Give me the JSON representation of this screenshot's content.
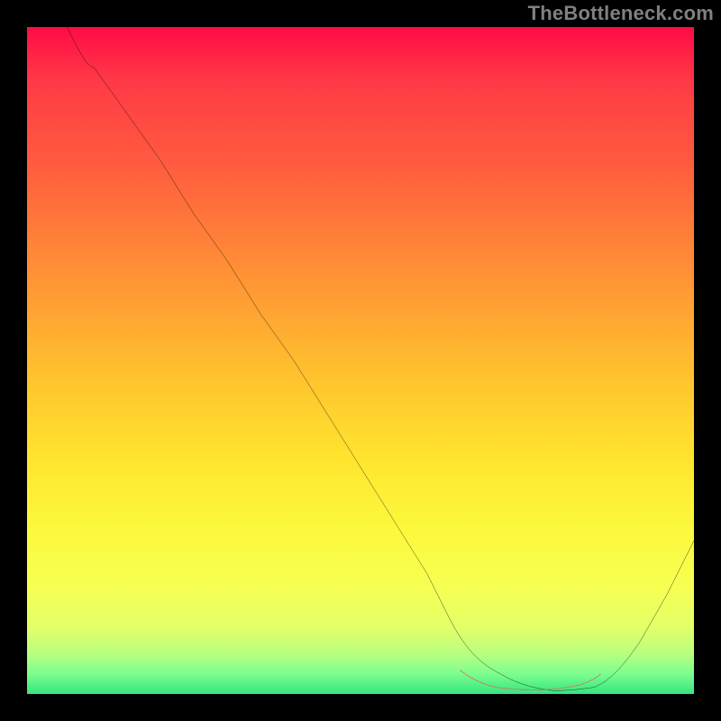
{
  "watermark": "TheBottleneck.com",
  "chart_data": {
    "type": "line",
    "title": "",
    "xlabel": "",
    "ylabel": "",
    "xlim": [
      0,
      100
    ],
    "ylim": [
      0,
      100
    ],
    "grid": false,
    "legend": false,
    "gradient_bands": [
      {
        "y_pct": 0,
        "color": "#34e57f"
      },
      {
        "y_pct": 3,
        "color": "#7cfd8e"
      },
      {
        "y_pct": 6,
        "color": "#b7ff80"
      },
      {
        "y_pct": 10,
        "color": "#e3ff69"
      },
      {
        "y_pct": 16,
        "color": "#f6ff52"
      },
      {
        "y_pct": 25,
        "color": "#fcf83c"
      },
      {
        "y_pct": 35,
        "color": "#ffe52e"
      },
      {
        "y_pct": 48,
        "color": "#ffc12e"
      },
      {
        "y_pct": 65,
        "color": "#ff8b36"
      },
      {
        "y_pct": 80,
        "color": "#ff5a3f"
      },
      {
        "y_pct": 92,
        "color": "#ff3946"
      },
      {
        "y_pct": 100,
        "color": "#ff0b46"
      }
    ],
    "series": [
      {
        "name": "bottleneck-curve",
        "color": "#000000",
        "width": 2,
        "x": [
          6,
          10,
          15,
          20,
          25,
          30,
          35,
          40,
          45,
          50,
          55,
          60,
          63,
          67,
          71,
          75,
          79,
          82,
          85,
          88,
          92,
          96,
          100
        ],
        "y": [
          100,
          94,
          87,
          80,
          72,
          65,
          57,
          50,
          42,
          34,
          26,
          18,
          12,
          6,
          3,
          1,
          0.5,
          0.5,
          1,
          3,
          8,
          15,
          23
        ]
      },
      {
        "name": "optimal-marker",
        "color": "#e06666",
        "width": 5,
        "x": [
          65,
          68,
          71,
          74,
          77,
          80,
          83,
          86
        ],
        "y": [
          3.5,
          1.8,
          1.0,
          0.7,
          0.7,
          0.9,
          1.5,
          3.0
        ]
      }
    ],
    "optimal_range_x": [
      65,
      86
    ]
  },
  "colors": {
    "frame": "#000000",
    "watermark": "#808080",
    "curve": "#000000",
    "marker": "#e06666"
  }
}
